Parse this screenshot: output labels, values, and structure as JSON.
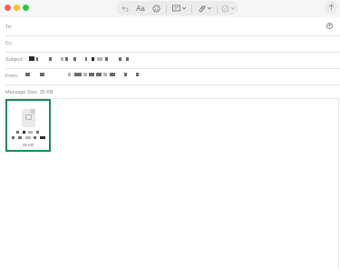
{
  "toolbar": {
    "format_button_label": "Aa"
  },
  "fields": {
    "to_label": "To:",
    "cc_label": "Cc:",
    "subject_label": "Subject:",
    "from_label": "From:"
  },
  "message_size_text": "Message Size: 35 KB",
  "attachment": {
    "size_label": "25 KB"
  },
  "icons": [
    "undo-icon",
    "format-icon",
    "emoji-icon",
    "photo-browser-icon",
    "attach-icon",
    "markup-icon",
    "send-icon",
    "add-recipient-icon",
    "document-icon"
  ],
  "colors": {
    "selection_border": "#1d8a5a",
    "close": "#ff5f57",
    "minimize": "#febc2e",
    "zoom": "#28c840"
  }
}
